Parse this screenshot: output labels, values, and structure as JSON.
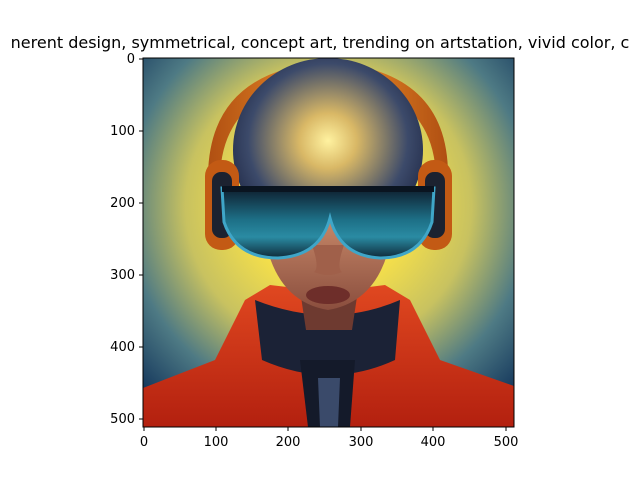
{
  "figure": {
    "title": "nerent design, symmetrical,  concept art, trending on artstation, vivid color, c",
    "x_ticks": [
      "0",
      "100",
      "200",
      "300",
      "400",
      "500"
    ],
    "y_ticks": [
      "0",
      "100",
      "200",
      "300",
      "400",
      "500"
    ],
    "image_subject": "portrait-with-headphones-and-visor"
  },
  "chart_data": {
    "type": "image",
    "title": "nerent design, symmetrical,  concept art, trending on artstation, vivid color, c",
    "xlim": [
      0,
      512
    ],
    "ylim": [
      512,
      0
    ],
    "x_ticks": [
      0,
      100,
      200,
      300,
      400,
      500
    ],
    "y_ticks": [
      0,
      100,
      200,
      300,
      400,
      500
    ],
    "colors": {
      "background_glow": "#f6e04a",
      "background_edge": "#1e4a6e",
      "helmet": "#e07a1e",
      "visor": "#1d6f86",
      "jacket": "#d8321c"
    }
  }
}
